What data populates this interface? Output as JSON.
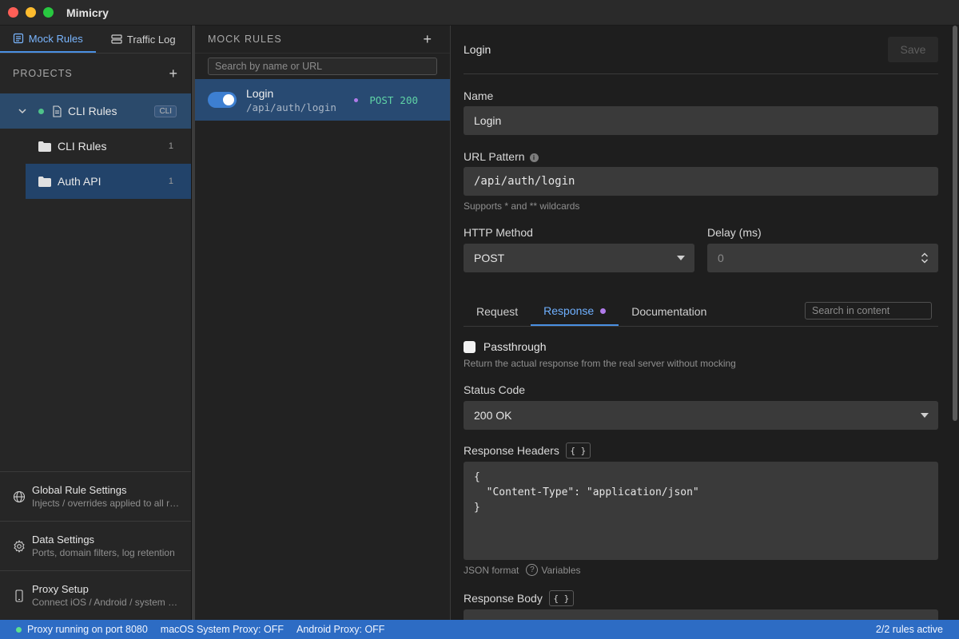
{
  "app": {
    "title": "Mimicry"
  },
  "sidebar": {
    "tabs": [
      {
        "label": "Mock Rules",
        "icon": "list-icon",
        "active": true
      },
      {
        "label": "Traffic Log",
        "icon": "server-icon",
        "active": false
      }
    ],
    "projects_heading": "PROJECTS",
    "add_symbol": "+",
    "project": {
      "name": "CLI Rules",
      "badge": "CLI",
      "status_color": "#4fc28a"
    },
    "folders": [
      {
        "name": "CLI Rules",
        "count": "1",
        "selected": false
      },
      {
        "name": "Auth API",
        "count": "1",
        "selected": true
      }
    ],
    "bottom_items": [
      {
        "title": "Global Rule Settings",
        "subtitle": "Injects / overrides applied to all rules",
        "icon": "globe-icon"
      },
      {
        "title": "Data Settings",
        "subtitle": "Ports, domain filters, log retention",
        "icon": "gear-icon"
      },
      {
        "title": "Proxy Setup",
        "subtitle": "Connect iOS / Android / system proxy",
        "icon": "phone-icon"
      }
    ]
  },
  "rules_panel": {
    "heading": "MOCK RULES",
    "add_symbol": "+",
    "search_placeholder": "Search by name or URL",
    "rules": [
      {
        "name": "Login",
        "url": "/api/auth/login",
        "method": "POST",
        "status": "200",
        "enabled": true
      }
    ]
  },
  "editor": {
    "title": "Login",
    "save_label": "Save",
    "name_label": "Name",
    "name_value": "Login",
    "url_label": "URL Pattern",
    "url_value": "/api/auth/login",
    "url_hint": "Supports * and ** wildcards",
    "method_label": "HTTP Method",
    "method_value": "POST",
    "delay_label": "Delay (ms)",
    "delay_placeholder": "0",
    "tabs": [
      {
        "label": "Request",
        "active": false
      },
      {
        "label": "Response",
        "active": true
      },
      {
        "label": "Documentation",
        "active": false
      }
    ],
    "content_search_placeholder": "Search in content",
    "passthrough_label": "Passthrough",
    "passthrough_hint": "Return the actual response from the real server without mocking",
    "status_code_label": "Status Code",
    "status_code_value": "200 OK",
    "headers_label": "Response Headers",
    "brace_label": "{ }",
    "headers_code": "{\n  \"Content-Type\": \"application/json\"\n}",
    "json_format_label": "JSON format",
    "variables_label": "Variables",
    "body_label": "Response Body",
    "body_code": "{"
  },
  "statusbar": {
    "proxy_status": "Proxy running on port 8080",
    "macos_proxy": "macOS System Proxy: OFF",
    "android_proxy": "Android Proxy: OFF",
    "rules_active": "2/2 rules active"
  }
}
